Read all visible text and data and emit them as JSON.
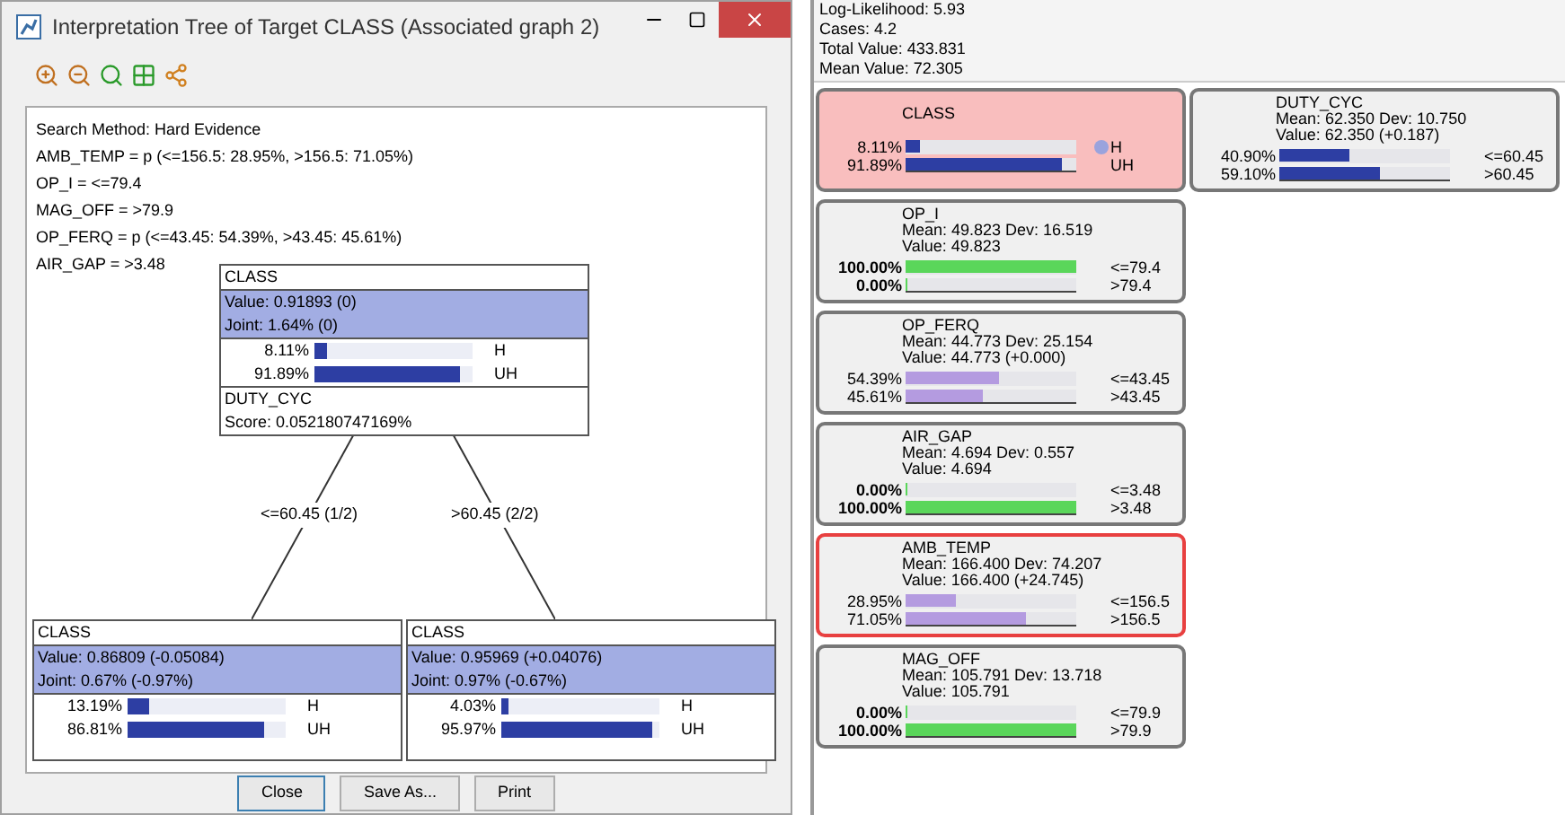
{
  "dialog": {
    "title": "Interpretation Tree of Target CLASS (Associated graph 2)",
    "evidence_lines": [
      "Search Method: Hard Evidence",
      "AMB_TEMP = p (<=156.5: 28.95%, >156.5: 71.05%)",
      "OP_I = <=79.4",
      "MAG_OFF = >79.9",
      "OP_FERQ = p (<=43.45: 54.39%, >43.45: 45.61%)",
      "AIR_GAP = >3.48"
    ],
    "tree": {
      "root": {
        "title": "CLASS",
        "value": "Value: 0.91893 (0)",
        "joint": "Joint: 1.64% (0)",
        "states": [
          {
            "percent": "8.11%",
            "level": 0.0811,
            "label": "H"
          },
          {
            "percent": "91.89%",
            "level": 0.9189,
            "label": "UH"
          }
        ],
        "split": {
          "variable": "DUTY_CYC",
          "score": "Score: 0.052180747169%"
        }
      },
      "branches": [
        {
          "label": "<=60.45 (1/2)",
          "node": {
            "title": "CLASS",
            "value": "Value: 0.86809 (-0.05084)",
            "joint": "Joint: 0.67% (-0.97%)",
            "states": [
              {
                "percent": "13.19%",
                "level": 0.1319,
                "label": "H"
              },
              {
                "percent": "86.81%",
                "level": 0.8681,
                "label": "UH"
              }
            ]
          }
        },
        {
          "label": ">60.45 (2/2)",
          "node": {
            "title": "CLASS",
            "value": "Value: 0.95969 (+0.04076)",
            "joint": "Joint: 0.97% (-0.67%)",
            "states": [
              {
                "percent": "4.03%",
                "level": 0.0403,
                "label": "H"
              },
              {
                "percent": "95.97%",
                "level": 0.9597,
                "label": "UH"
              }
            ]
          }
        }
      ]
    },
    "buttons": [
      {
        "label": "Close",
        "focused": true
      },
      {
        "label": "Save As...",
        "focused": false
      },
      {
        "label": "Print",
        "focused": false
      }
    ]
  },
  "stats": [
    "Log-Likelihood: 5.93",
    "Cases: 4.2",
    "Total Value: 433.831",
    "Mean Value: 72.305"
  ],
  "monitors": [
    {
      "kind": "target",
      "selected": false,
      "title": "CLASS",
      "states": [
        {
          "percent": "8.11%",
          "level": 0.0811,
          "label": "H",
          "targeted": true
        },
        {
          "percent": "91.89%",
          "level": 0.9189,
          "label": "UH",
          "targeted": false
        }
      ]
    },
    {
      "kind": "hard_evidence",
      "selected": false,
      "title": "OP_I",
      "lines": [
        "Mean: 49.823 Dev: 16.519",
        "Value: 49.823"
      ],
      "states": [
        {
          "percent": "100.00%",
          "level": 1,
          "label": "<=79.4"
        },
        {
          "percent": "0.00%",
          "level": 0,
          "label": ">79.4"
        }
      ]
    },
    {
      "kind": "soft_evidence",
      "selected": false,
      "title": "OP_FERQ",
      "lines": [
        "Mean: 44.773 Dev: 25.154",
        "Value: 44.773 (+0.000)"
      ],
      "states": [
        {
          "percent": "54.39%",
          "level": 0.5439,
          "label": "<=43.45"
        },
        {
          "percent": "45.61%",
          "level": 0.4561,
          "label": ">43.45"
        }
      ]
    },
    {
      "kind": "hard_evidence",
      "selected": false,
      "title": "AIR_GAP",
      "lines": [
        "Mean: 4.694 Dev: 0.557",
        "Value: 4.694"
      ],
      "states": [
        {
          "percent": "0.00%",
          "level": 0,
          "label": "<=3.48"
        },
        {
          "percent": "100.00%",
          "level": 1,
          "label": ">3.48"
        }
      ]
    },
    {
      "kind": "soft_evidence",
      "selected": true,
      "title": "AMB_TEMP",
      "lines": [
        "Mean: 166.400 Dev: 74.207",
        "Value: 166.400 (+24.745)"
      ],
      "states": [
        {
          "percent": "28.95%",
          "level": 0.2895,
          "label": "<=156.5"
        },
        {
          "percent": "71.05%",
          "level": 0.7105,
          "label": ">156.5"
        }
      ]
    },
    {
      "kind": "hard_evidence",
      "selected": false,
      "title": "MAG_OFF",
      "lines": [
        "Mean: 105.791 Dev: 13.718",
        "Value: 105.791"
      ],
      "states": [
        {
          "percent": "0.00%",
          "level": 0,
          "label": "<=79.9"
        },
        {
          "percent": "100.00%",
          "level": 1,
          "label": ">79.9"
        }
      ]
    },
    {
      "kind": "plain",
      "selected": false,
      "title": "DUTY_CYC",
      "lines": [
        "Mean: 62.350 Dev: 10.750",
        "Value: 62.350 (+0.187)"
      ],
      "states": [
        {
          "percent": "40.90%",
          "level": 0.409,
          "label": "<=60.45"
        },
        {
          "percent": "59.10%",
          "level": 0.591,
          "label": ">60.45"
        }
      ]
    }
  ]
}
